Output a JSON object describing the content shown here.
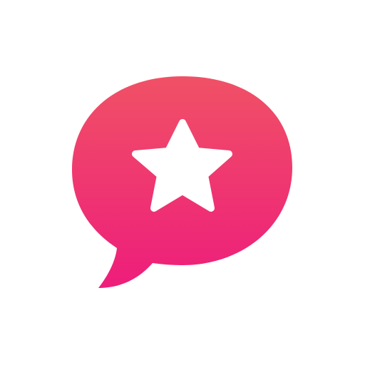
{
  "icon": {
    "name": "chat-bubble-star-icon",
    "colors": {
      "background": "#ffffff",
      "bubble_gradient_top": "#f05166",
      "bubble_gradient_bottom": "#ee1d7b",
      "star": "#ffffff"
    }
  }
}
